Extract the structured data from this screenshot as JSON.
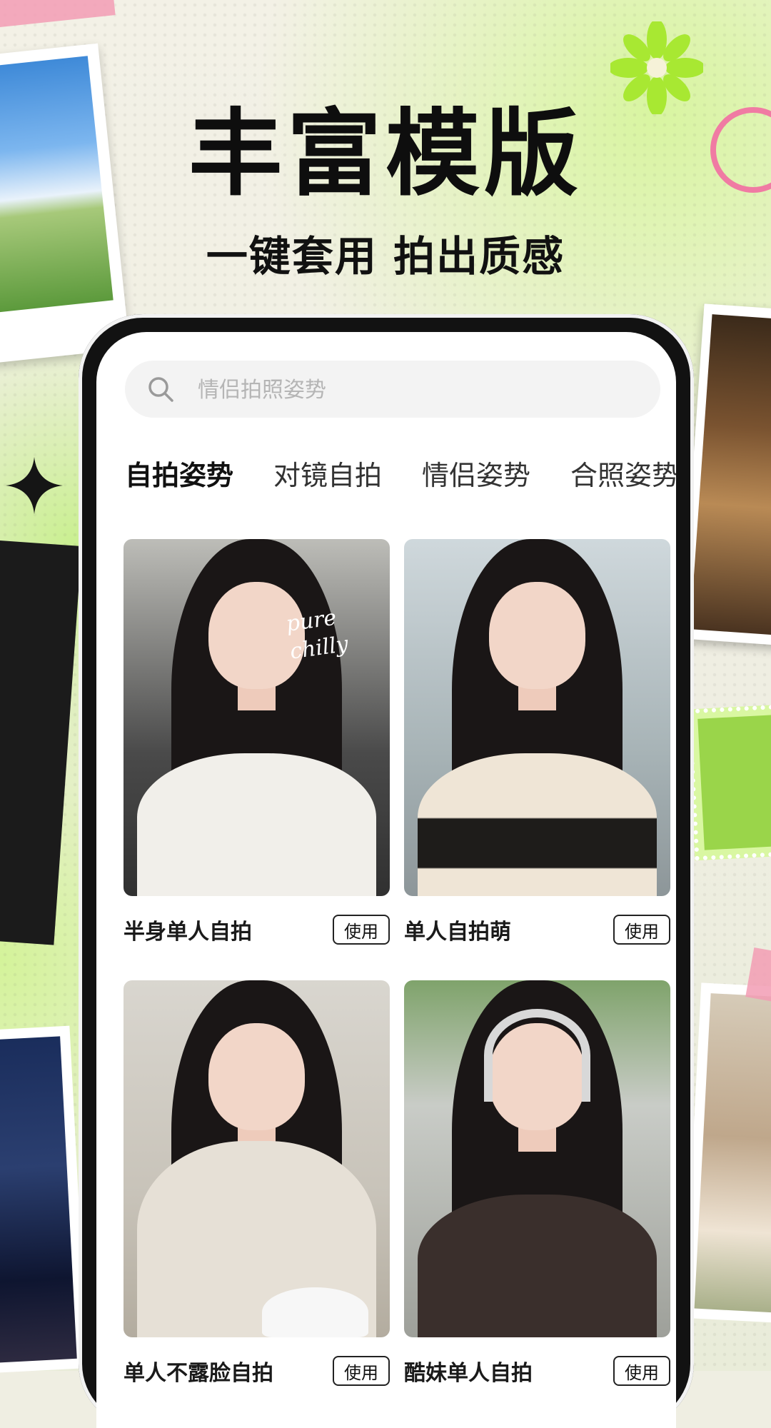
{
  "header": {
    "title": "丰富模版",
    "subtitle": "一键套用 拍出质感"
  },
  "search": {
    "placeholder": "情侣拍照姿势",
    "icon": "search-icon"
  },
  "tabs": [
    {
      "label": "自拍姿势",
      "active": true
    },
    {
      "label": "对镜自拍",
      "active": false
    },
    {
      "label": "情侣姿势",
      "active": false
    },
    {
      "label": "合照姿势",
      "active": false
    }
  ],
  "templates": [
    {
      "title": "半身单人自拍",
      "button": "使用",
      "overlay_text": "pure chilly"
    },
    {
      "title": "单人自拍萌",
      "button": "使用"
    },
    {
      "title": "单人不露脸自拍",
      "button": "使用"
    },
    {
      "title": "酷妹单人自拍",
      "button": "使用"
    }
  ],
  "colors": {
    "accent_green": "#c9ef66",
    "accent_pink": "#f07ba3",
    "text_dark": "#111111"
  }
}
